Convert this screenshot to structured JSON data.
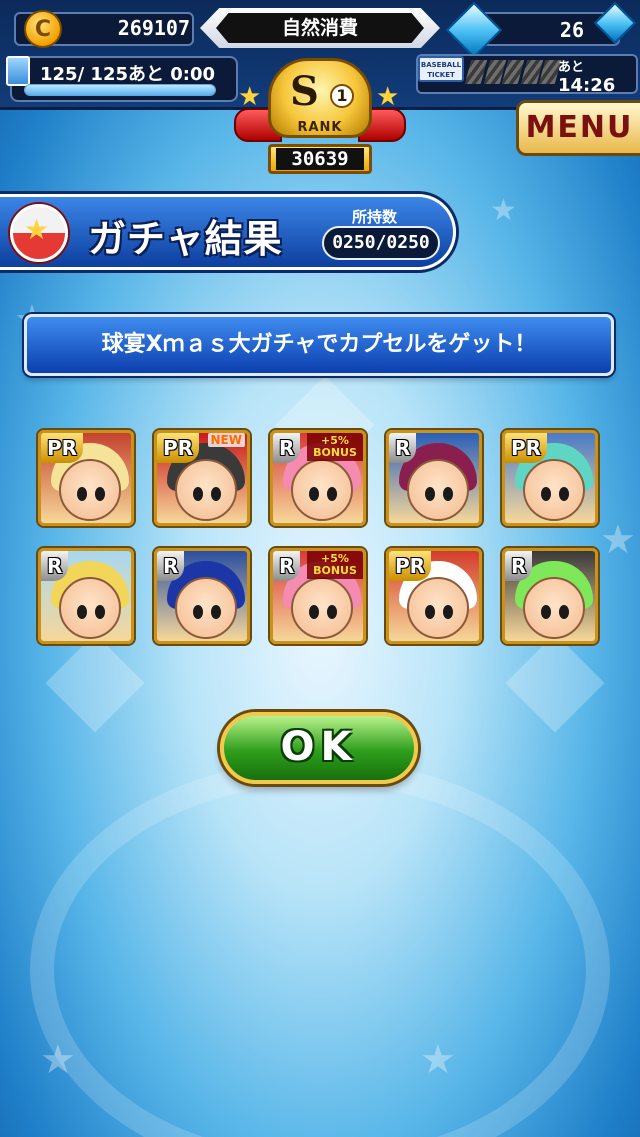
{
  "header": {
    "coins": "269107",
    "mode": "自然消費",
    "gems": "26",
    "stamina": "125/ 125あと  0:00",
    "stamina_fraction": 1.0,
    "ticket_label": "BASEBALL TICKET",
    "ticket_ato": "あと",
    "ticket_time": "14:26",
    "menu_label": "MENU"
  },
  "rank": {
    "tier": "S",
    "level": "1",
    "word": "RANK",
    "score": "30639"
  },
  "result": {
    "title": "ガチャ結果",
    "owned_label": "所持数",
    "owned_value": "0250/0250",
    "message": "球宴Xｍａｓ大ガチャでカプセルをゲット！"
  },
  "cards": [
    {
      "rarity": "PR",
      "new": "",
      "bonus": "",
      "hair": "#f5e39a",
      "bg": "#c5422f"
    },
    {
      "rarity": "PR",
      "new": "NEW",
      "bonus": "",
      "hair": "#3a3a3a",
      "bg": "#c91a1a"
    },
    {
      "rarity": "R",
      "new": "",
      "bonus": "+5% BONUS",
      "hair": "#f58bb0",
      "bg": "#d83a3a"
    },
    {
      "rarity": "R",
      "new": "",
      "bonus": "",
      "hair": "#8a1f4f",
      "bg": "#2a5fb8"
    },
    {
      "rarity": "PR",
      "new": "",
      "bonus": "",
      "hair": "#5fd6c4",
      "bg": "#4a7ac8"
    },
    {
      "rarity": "R",
      "new": "",
      "bonus": "",
      "hair": "#f2d65a",
      "bg": "#a8d8f0"
    },
    {
      "rarity": "R",
      "new": "",
      "bonus": "",
      "hair": "#1c36a8",
      "bg": "#2a4fa0"
    },
    {
      "rarity": "R",
      "new": "",
      "bonus": "+5% BONUS",
      "hair": "#f58bb0",
      "bg": "#d83a3a"
    },
    {
      "rarity": "PR",
      "new": "",
      "bonus": "",
      "hair": "#ffffff",
      "bg": "#d43c2c"
    },
    {
      "rarity": "R",
      "new": "",
      "bonus": "",
      "hair": "#7fe85a",
      "bg": "#3a3a3a"
    }
  ],
  "ok_label": "OK"
}
